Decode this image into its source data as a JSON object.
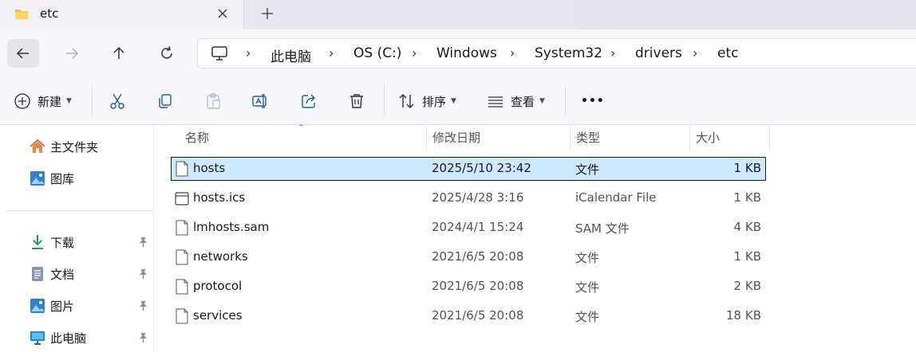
{
  "window": {
    "tab_title": "etc",
    "tab_icon": "folder-icon",
    "accent_color": "#0067c0",
    "selection_color": "#cce8ff"
  },
  "address": {
    "crumbs": [
      "此电脑",
      "OS (C:)",
      "Windows",
      "System32",
      "drivers",
      "etc"
    ],
    "separator": "›"
  },
  "commands": {
    "new_label": "新建",
    "sort_label": "排序",
    "view_label": "查看",
    "more_label": "•••"
  },
  "sidebar": {
    "items": [
      {
        "label": "主文件夹",
        "icon": "home-icon",
        "pinned": false
      },
      {
        "label": "图库",
        "icon": "gallery-icon",
        "pinned": false
      },
      {
        "label": "下载",
        "icon": "download-icon",
        "pinned": true
      },
      {
        "label": "文档",
        "icon": "document-icon",
        "pinned": true
      },
      {
        "label": "图片",
        "icon": "pictures-icon",
        "pinned": true
      },
      {
        "label": "此电脑",
        "icon": "computer-icon",
        "pinned": true
      }
    ]
  },
  "filelist": {
    "columns": [
      "名称",
      "修改日期",
      "类型",
      "大小"
    ],
    "rows": [
      {
        "name": "hosts",
        "date": "2025/5/10 23:42",
        "type": "文件",
        "size": "1 KB",
        "selected": true,
        "icon": "file-icon"
      },
      {
        "name": "hosts.ics",
        "date": "2025/4/28 3:16",
        "type": "iCalendar File",
        "size": "1 KB",
        "selected": false,
        "icon": "calendar-file-icon"
      },
      {
        "name": "lmhosts.sam",
        "date": "2024/4/1 15:24",
        "type": "SAM 文件",
        "size": "4 KB",
        "selected": false,
        "icon": "file-icon"
      },
      {
        "name": "networks",
        "date": "2021/6/5 20:08",
        "type": "文件",
        "size": "1 KB",
        "selected": false,
        "icon": "file-icon"
      },
      {
        "name": "protocol",
        "date": "2021/6/5 20:08",
        "type": "文件",
        "size": "2 KB",
        "selected": false,
        "icon": "file-icon"
      },
      {
        "name": "services",
        "date": "2021/6/5 20:08",
        "type": "文件",
        "size": "18 KB",
        "selected": false,
        "icon": "file-icon"
      }
    ]
  }
}
